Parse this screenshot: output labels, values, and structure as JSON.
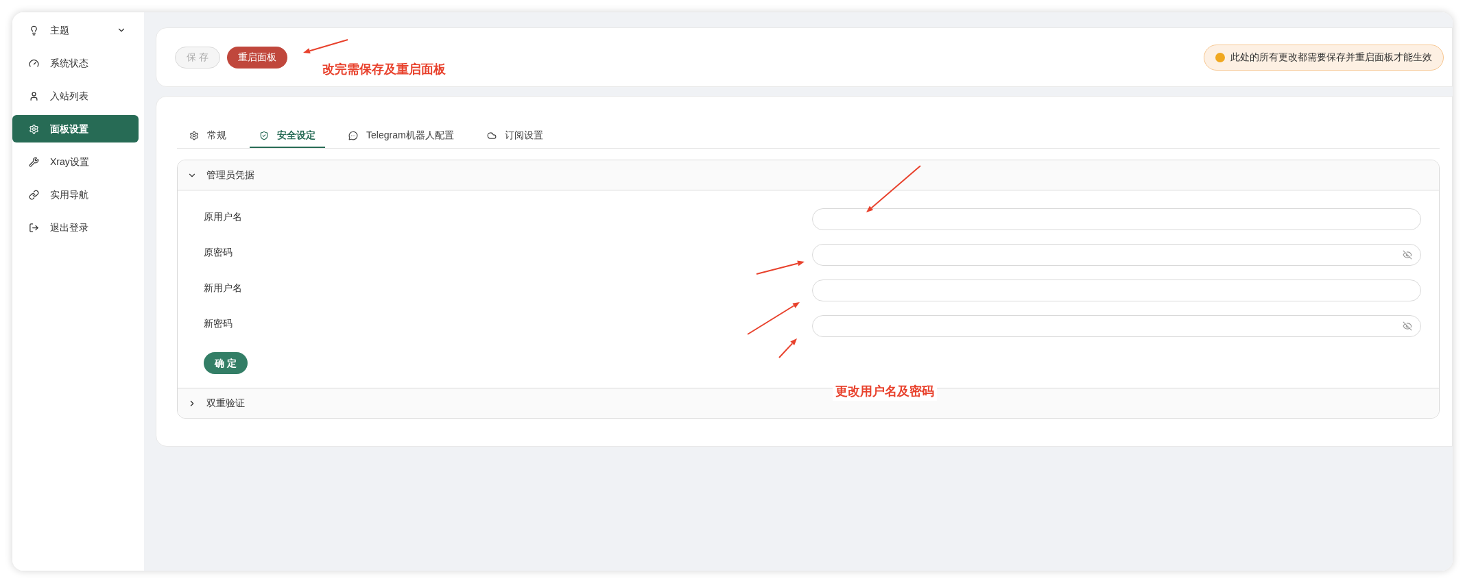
{
  "sidebar": {
    "items": [
      {
        "label": "主题",
        "selected": false,
        "submenu": true
      },
      {
        "label": "系统状态",
        "selected": false,
        "submenu": false
      },
      {
        "label": "入站列表",
        "selected": false,
        "submenu": false
      },
      {
        "label": "面板设置",
        "selected": true,
        "submenu": false
      },
      {
        "label": "Xray设置",
        "selected": false,
        "submenu": false
      },
      {
        "label": "实用导航",
        "selected": false,
        "submenu": false
      },
      {
        "label": "退出登录",
        "selected": false,
        "submenu": false
      }
    ]
  },
  "toolbar": {
    "buttons": [
      {
        "label": "保 存",
        "disabled": true
      },
      {
        "label": "重启面板",
        "disabled": false
      }
    ],
    "alert": "此处的所有更改都需要保存并重启面板才能生效"
  },
  "tabs": [
    {
      "label": "常规",
      "selected": false
    },
    {
      "label": "安全设定",
      "selected": true
    },
    {
      "label": "Telegram机器人配置",
      "selected": false
    },
    {
      "label": "订阅设置",
      "selected": false
    }
  ],
  "panels": [
    {
      "title": "管理员凭据",
      "expanded": true,
      "fields": [
        {
          "label": "原用户名",
          "kind": "text"
        },
        {
          "label": "原密码",
          "kind": "password"
        },
        {
          "label": "新用户名",
          "kind": "text"
        },
        {
          "label": "新密码",
          "kind": "password"
        }
      ],
      "button": "确 定"
    },
    {
      "title": "双重验证",
      "expanded": false
    }
  ],
  "annotations": [
    "改完需保存及重启面板",
    "更改用户名及密码"
  ]
}
